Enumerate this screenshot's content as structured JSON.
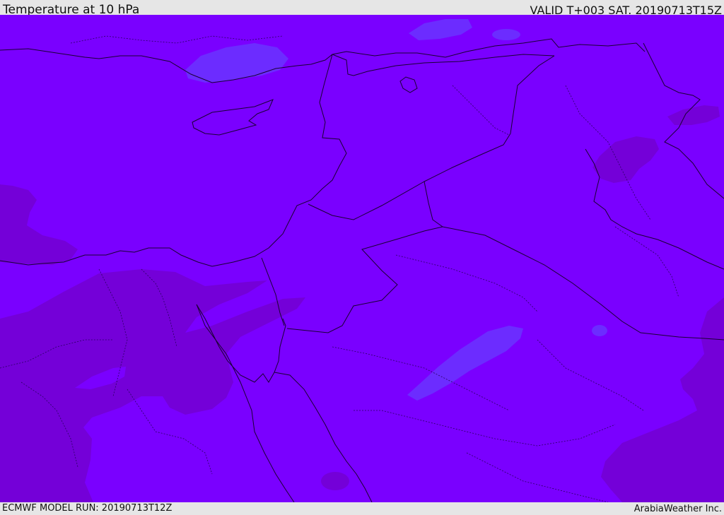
{
  "header": {
    "title": "Temperature at 10 hPa",
    "valid": "VALID T+003 SAT. 20190713T15Z"
  },
  "footer": {
    "model_run": "ECMWF MODEL RUN: 20190713T12Z",
    "credit": "ArabiaWeather Inc."
  },
  "colors": {
    "base_fill": "#7a00ff",
    "warmer_fill": "#7500d9",
    "cooler_fill": "#6a2cff",
    "coastline": "#1a0033",
    "borders": "#2a0060"
  }
}
